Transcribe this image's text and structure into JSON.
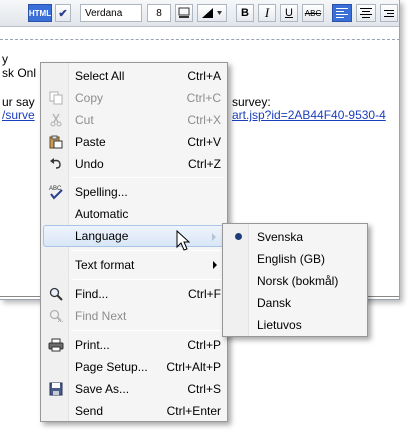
{
  "toolbar": {
    "html_label": "HTML",
    "check_glyph": "✔",
    "font_value": "Verdana",
    "size_value": "8",
    "bold": "B",
    "italic": "I",
    "underline": "U",
    "strike": "ABC"
  },
  "body": {
    "line1": "y",
    "line2": "sk Onl",
    "line3_prefix": "ur say",
    "line3_suffix": "survey:",
    "link_left": "/surve",
    "link_right": "art.jsp?id=2AB44F40-9530-4"
  },
  "menu": {
    "items": [
      {
        "label": "Select All",
        "shortcut": "Ctrl+A",
        "icon": "none",
        "disabled": false
      },
      {
        "label": "Copy",
        "shortcut": "Ctrl+C",
        "icon": "copy-icon",
        "disabled": true
      },
      {
        "label": "Cut",
        "shortcut": "Ctrl+X",
        "icon": "cut-icon",
        "disabled": true
      },
      {
        "label": "Paste",
        "shortcut": "Ctrl+V",
        "icon": "paste-icon",
        "disabled": false
      },
      {
        "label": "Undo",
        "shortcut": "Ctrl+Z",
        "icon": "undo-icon",
        "disabled": false
      },
      {
        "label": "Spelling...",
        "shortcut": "",
        "icon": "spelling-icon",
        "disabled": false
      },
      {
        "label": "Automatic",
        "shortcut": "",
        "icon": "none",
        "disabled": false
      },
      {
        "label": "Language",
        "shortcut": "",
        "icon": "none",
        "disabled": false,
        "submenu": true
      },
      {
        "label": "Text format",
        "shortcut": "",
        "icon": "none",
        "disabled": false,
        "submenu": true
      },
      {
        "label": "Find...",
        "shortcut": "Ctrl+F",
        "icon": "find-icon",
        "disabled": false
      },
      {
        "label": "Find Next",
        "shortcut": "",
        "icon": "find-next-icon",
        "disabled": true
      },
      {
        "label": "Print...",
        "shortcut": "Ctrl+P",
        "icon": "print-icon",
        "disabled": false
      },
      {
        "label": "Page Setup...",
        "shortcut": "Ctrl+Alt+P",
        "icon": "none",
        "disabled": false
      },
      {
        "label": "Save As...",
        "shortcut": "Ctrl+S",
        "icon": "save-icon",
        "disabled": false
      },
      {
        "label": "Send",
        "shortcut": "Ctrl+Enter",
        "icon": "none",
        "disabled": false
      }
    ]
  },
  "submenu": {
    "items": [
      {
        "label": "Svenska",
        "selected": true
      },
      {
        "label": "English (GB)",
        "selected": false
      },
      {
        "label": "Norsk (bokmål)",
        "selected": false
      },
      {
        "label": "Dansk",
        "selected": false
      },
      {
        "label": "Lietuvos",
        "selected": false
      }
    ]
  },
  "colors": {
    "accent": "#3a6fd8",
    "link": "#1a3ebf",
    "hover_bg": "#d9e6f7",
    "hover_border": "#a8c4e6",
    "radio_dot": "#1c3f7a"
  }
}
